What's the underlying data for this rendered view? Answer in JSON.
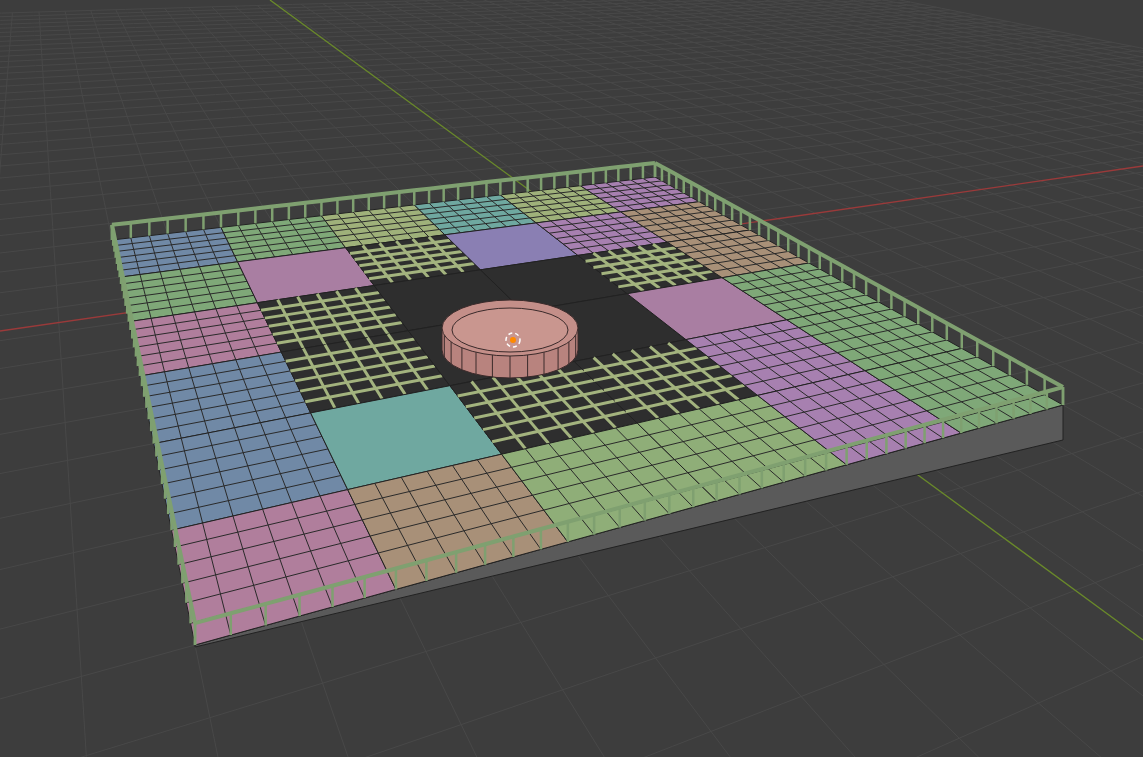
{
  "viewport": {
    "patches": [
      {
        "kind": "mesh",
        "color": "#7089a6"
      },
      {
        "kind": "mesh",
        "color": "#7fa878"
      },
      {
        "kind": "mesh",
        "color": "#9fb17a"
      },
      {
        "kind": "mesh",
        "color": "#6fa8a0"
      },
      {
        "kind": "mesh",
        "color": "#9fb17a"
      },
      {
        "kind": "mesh",
        "color": "#a780b0"
      },
      {
        "kind": "mesh",
        "color": "#7fa878"
      },
      {
        "kind": "flat",
        "color": "#a97ea2"
      },
      {
        "kind": "lattice"
      },
      {
        "kind": "flat",
        "color": "#8a7fb3"
      },
      {
        "kind": "mesh",
        "color": "#a780b0"
      },
      {
        "kind": "mesh",
        "color": "#a89078"
      },
      {
        "kind": "mesh",
        "color": "#b07e9c"
      },
      {
        "kind": "lattice"
      },
      {
        "kind": "hub"
      },
      {
        "kind": "hub"
      },
      {
        "kind": "lattice"
      },
      {
        "kind": "mesh",
        "color": "#a89078"
      },
      {
        "kind": "mesh",
        "color": "#7089a6"
      },
      {
        "kind": "lattice"
      },
      {
        "kind": "hub"
      },
      {
        "kind": "hub"
      },
      {
        "kind": "flat",
        "color": "#a97ea2"
      },
      {
        "kind": "mesh",
        "color": "#7fa878"
      },
      {
        "kind": "mesh",
        "color": "#7089a6"
      },
      {
        "kind": "flat",
        "color": "#6fa8a0"
      },
      {
        "kind": "lattice"
      },
      {
        "kind": "lattice"
      },
      {
        "kind": "mesh",
        "color": "#a780b0"
      },
      {
        "kind": "mesh",
        "color": "#7fa878"
      },
      {
        "kind": "mesh",
        "color": "#b07e9c"
      },
      {
        "kind": "mesh",
        "color": "#a89078"
      },
      {
        "kind": "mesh",
        "color": "#8fae78"
      },
      {
        "kind": "mesh",
        "color": "#8fae78"
      },
      {
        "kind": "mesh",
        "color": "#a780b0"
      },
      {
        "kind": "mesh",
        "color": "#7fa878"
      }
    ]
  }
}
